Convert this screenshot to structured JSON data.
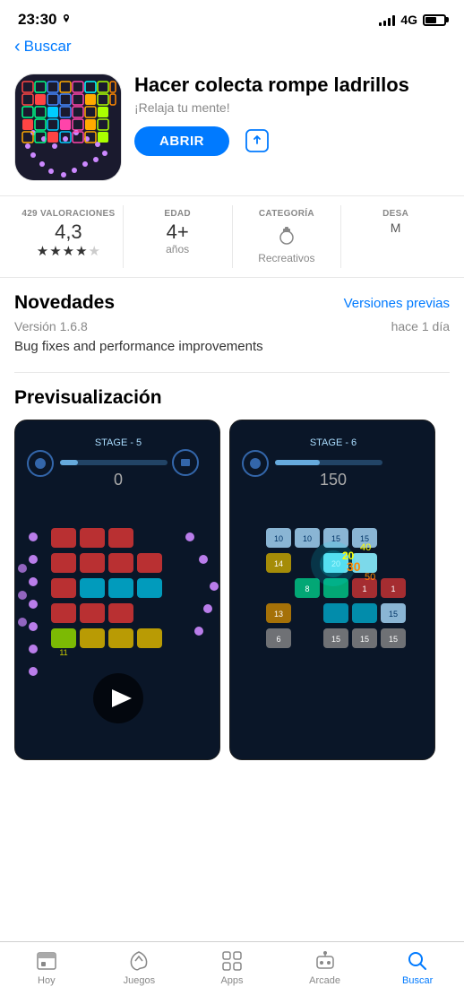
{
  "statusBar": {
    "time": "23:30",
    "signal": "4G"
  },
  "header": {
    "backLabel": "Buscar"
  },
  "app": {
    "title": "Hacer colecta rompe ladrillos",
    "subtitle": "¡Relaja tu mente!",
    "openButton": "ABRIR",
    "ratings": {
      "count": "429 VALORACIONES",
      "score": "4,3",
      "starsLabel": "★★★★☆",
      "age": "4+",
      "ageLabel": "años",
      "categoryLabel": "CATEGORÍA",
      "categoryName": "Recreativos",
      "developerLabel": "DESA"
    }
  },
  "novedades": {
    "sectionTitle": "Novedades",
    "linkLabel": "Versiones previas",
    "version": "Versión 1.6.8",
    "date": "hace 1 día",
    "notes": "Bug fixes and performance improvements"
  },
  "preview": {
    "sectionTitle": "Previsualización"
  },
  "bottomNav": {
    "items": [
      {
        "id": "hoy",
        "label": "Hoy",
        "icon": "📋",
        "active": false
      },
      {
        "id": "juegos",
        "label": "Juegos",
        "icon": "🚀",
        "active": false
      },
      {
        "id": "apps",
        "label": "Apps",
        "icon": "🗂️",
        "active": false
      },
      {
        "id": "arcade",
        "label": "Arcade",
        "icon": "🕹️",
        "active": false
      },
      {
        "id": "buscar",
        "label": "Buscar",
        "icon": "🔍",
        "active": true
      }
    ]
  }
}
